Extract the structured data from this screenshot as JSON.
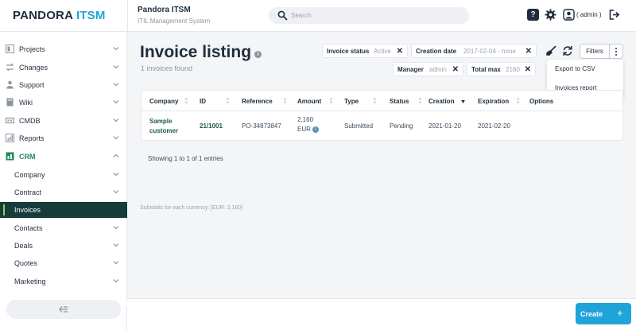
{
  "header": {
    "logo_main": "PANDORA",
    "logo_accent": "ITSM",
    "app_title": "Pandora ITSM",
    "app_subtitle": "ITIL Management System",
    "search_placeholder": "Search",
    "help_label": "?",
    "username": "( admin )"
  },
  "sidebar": {
    "items": [
      {
        "label": "Projects",
        "icon": "projects-icon"
      },
      {
        "label": "Changes",
        "icon": "changes-icon"
      },
      {
        "label": "Support",
        "icon": "support-icon"
      },
      {
        "label": "Wiki",
        "icon": "wiki-icon"
      },
      {
        "label": "CMDB",
        "icon": "cmdb-icon"
      },
      {
        "label": "Reports",
        "icon": "reports-icon"
      },
      {
        "label": "CRM",
        "icon": "crm-icon"
      }
    ],
    "crm_children": [
      "Company",
      "Contract",
      "Invoices",
      "Contacts",
      "Deals",
      "Quotes",
      "Marketing"
    ],
    "active_item": "Invoices"
  },
  "main": {
    "title": "Invoice listing",
    "found": "1 invoices found",
    "filters": [
      {
        "key": "Invoice status",
        "value": "Active"
      },
      {
        "key": "Creation date",
        "value": "2017-02-04 - none"
      },
      {
        "key": "Manager",
        "value": "admin"
      },
      {
        "key": "Total max",
        "value": "2160"
      }
    ],
    "filters_button": "Filters",
    "menu": [
      "Export to CSV",
      "Invoices report"
    ],
    "table": {
      "headers": [
        "Company",
        "ID",
        "Reference",
        "Amount",
        "Type",
        "Status",
        "Creation",
        "Expiration",
        "Options"
      ],
      "row": {
        "company_line1": "Sample",
        "company_line2": "customer",
        "id": "21/1001",
        "reference": "PO-34873847",
        "amount_line1": "2,160",
        "amount_line2": "EUR",
        "type": "Submitted",
        "status": "Pending",
        "creation": "2021-01-20",
        "expiration": "2021-02-20"
      }
    },
    "showing": "Showing 1 to 1 of 1 entries",
    "subtotals": "Subtotals for each currency: [EUR: 2,160]"
  },
  "footer": {
    "create_label": "Create",
    "create_plus": "+"
  },
  "colors": {
    "accent": "#1fa4d9",
    "sidebar_active": "#163b3b",
    "active_bar": "#8fd14f",
    "crm_green": "#1e8a5a"
  }
}
